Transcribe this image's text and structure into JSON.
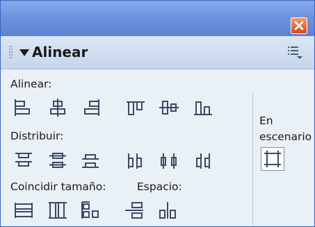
{
  "window": {
    "close_label": "Close"
  },
  "panel": {
    "title": "Alinear"
  },
  "sections": {
    "align_label": "Alinear:",
    "distribute_label": "Distribuir:",
    "match_size_label": "Coincidir tamaño:",
    "space_label": "Espacio:",
    "stage_label_line1": "En",
    "stage_label_line2": "escenario"
  },
  "icons": {
    "align_row": [
      "align-left-edge-icon",
      "align-horizontal-center-icon",
      "align-right-edge-icon",
      "align-top-edge-icon",
      "align-vertical-center-icon",
      "align-bottom-edge-icon"
    ],
    "distribute_row": [
      "distribute-top-icon",
      "distribute-vertical-center-icon",
      "distribute-bottom-icon",
      "distribute-left-icon",
      "distribute-horizontal-center-icon",
      "distribute-right-icon"
    ],
    "match_row": [
      "match-width-icon",
      "match-height-icon",
      "match-width-height-icon"
    ],
    "space_row": [
      "space-vertical-icon",
      "space-horizontal-icon"
    ],
    "stage": "to-stage-icon"
  },
  "colors": {
    "icon_stroke": "#3a4a62",
    "titlebar": "#6f94dd",
    "panel_bg": "#e9f0f6"
  }
}
